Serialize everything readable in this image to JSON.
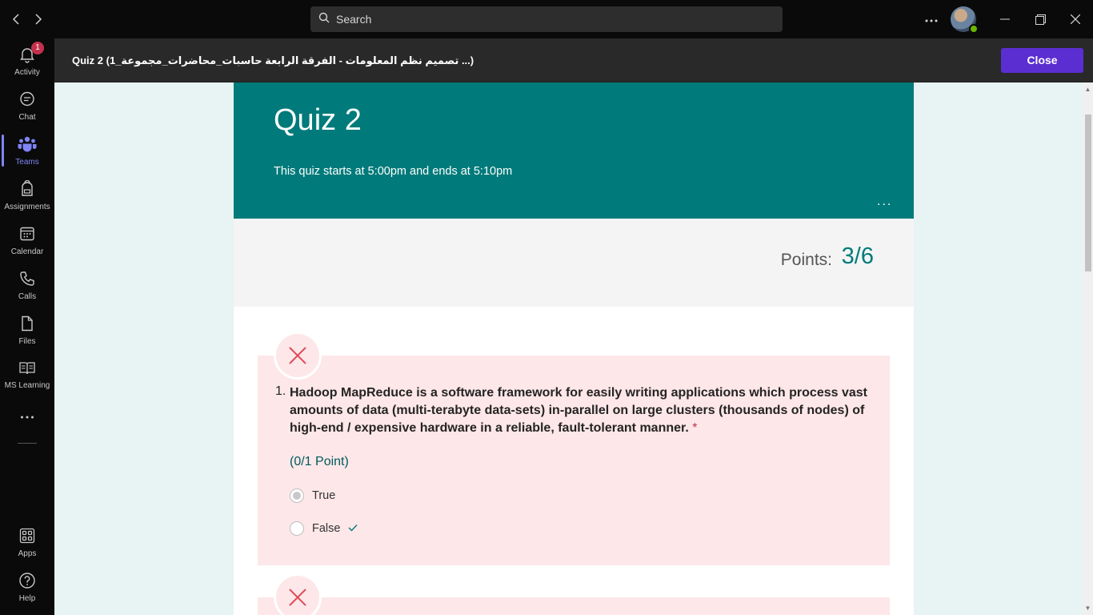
{
  "titlebar": {
    "search_placeholder": "Search"
  },
  "rail": {
    "items": [
      {
        "label": "Activity",
        "icon": "bell-icon",
        "badge": "1"
      },
      {
        "label": "Chat",
        "icon": "chat-icon"
      },
      {
        "label": "Teams",
        "icon": "teams-icon",
        "active": true
      },
      {
        "label": "Assignments",
        "icon": "backpack-icon"
      },
      {
        "label": "Calendar",
        "icon": "calendar-icon"
      },
      {
        "label": "Calls",
        "icon": "phone-icon"
      },
      {
        "label": "Files",
        "icon": "file-icon"
      },
      {
        "label": "MS Learning",
        "icon": "book-icon"
      },
      {
        "label": "Apps",
        "icon": "apps-icon"
      },
      {
        "label": "Help",
        "icon": "help-icon"
      }
    ],
    "more_label": "..."
  },
  "header": {
    "title": "Quiz 2 (تصميم نظم المعلومات - الفرقة الرابعة حاسبات_محاضرات_مجموعة_1 ...)",
    "close_label": "Close"
  },
  "form": {
    "title": "Quiz 2",
    "description": "This quiz starts at 5:00pm and ends at 5:10pm",
    "more": "...",
    "points_label": "Points:",
    "points_value": "3/6",
    "questions": [
      {
        "number": "1.",
        "text_line1": "Hadoop MapReduce is a software framework for easily writing applications which process vast amounts of data (multi-terabyte data-sets) in-parallel on large clusters (thousands of nodes) of",
        "text_line2": "high-end / expensive hardware in a reliable, fault-tolerant manner.",
        "required_mark": "*",
        "points": "(0/1 Point)",
        "options": [
          {
            "label": "True",
            "selected": true
          },
          {
            "label": "False",
            "correct": true
          }
        ]
      }
    ]
  },
  "colors": {
    "accent": "#5b2ed1",
    "teams_active": "#7f85f5",
    "form_header": "#007a7a",
    "wrong_bg": "#fde7e9",
    "wrong_icon": "#e04a5a"
  }
}
